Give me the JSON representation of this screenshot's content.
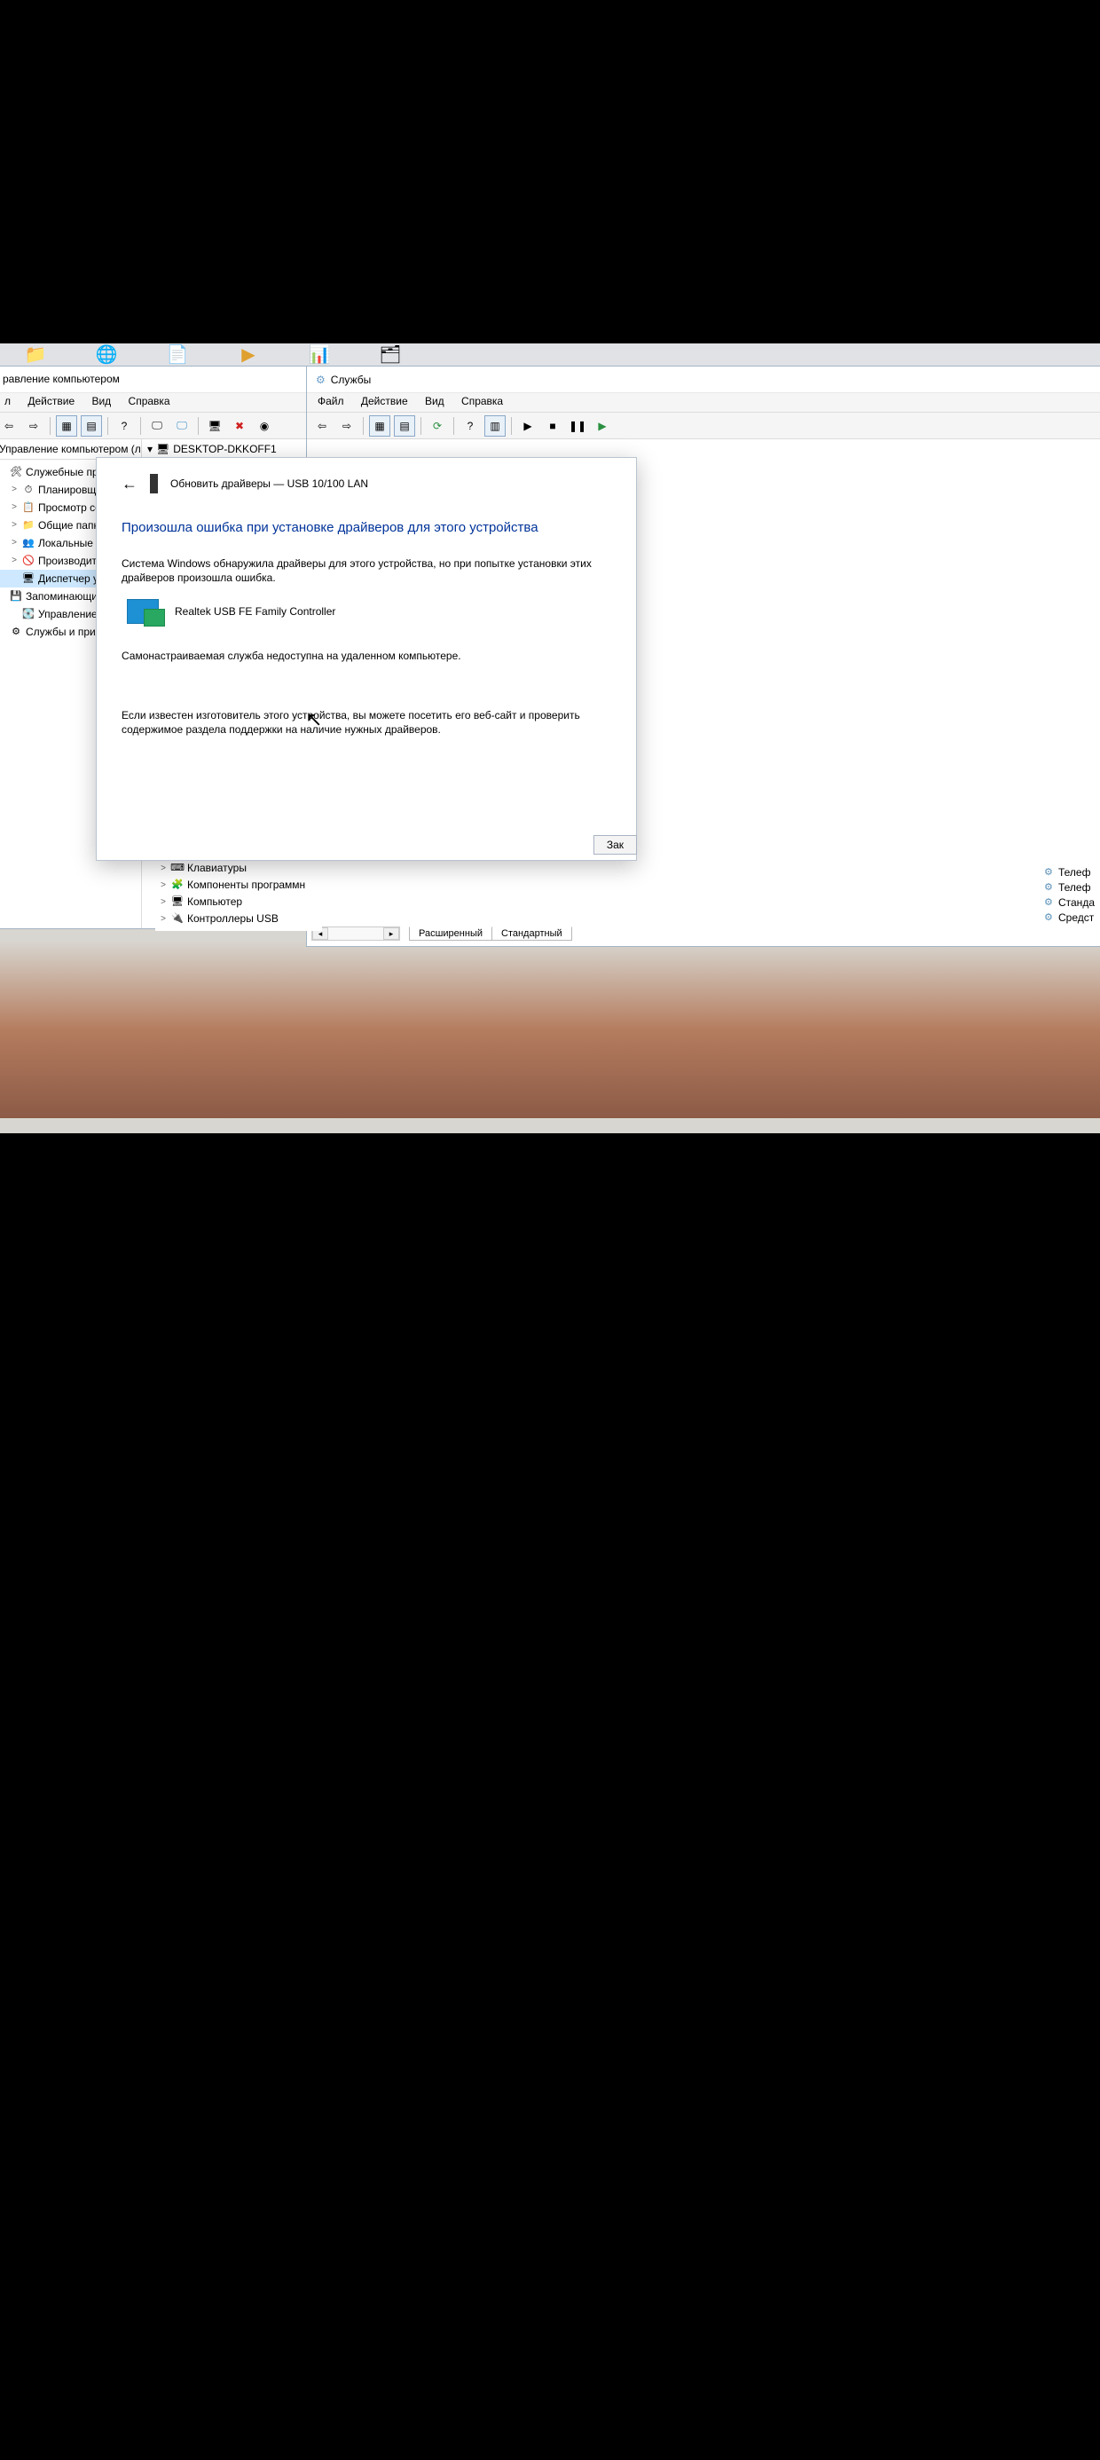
{
  "taskbar_icons": [
    "📁",
    "🌐",
    "📄",
    "▶",
    "📊",
    "🗂"
  ],
  "cm": {
    "title": "равление компьютером",
    "menu": {
      "file": "л",
      "action": "Действие",
      "view": "Вид",
      "help": "Справка"
    },
    "header_left": "Управление компьютером (лс",
    "header_right": "DESKTOP-DKKOFF1",
    "tree": [
      {
        "exp": "",
        "icon": "🛠",
        "label": "Служебные про"
      },
      {
        "exp": ">",
        "icon": "⏱",
        "label": "Планировщ",
        "ind": 1
      },
      {
        "exp": ">",
        "icon": "📋",
        "label": "Просмотр сс",
        "ind": 1
      },
      {
        "exp": ">",
        "icon": "📁",
        "label": "Общие папк",
        "ind": 1
      },
      {
        "exp": ">",
        "icon": "👥",
        "label": "Локальные п",
        "ind": 1
      },
      {
        "exp": ">",
        "icon": "🚫",
        "label": "Производит",
        "ind": 1
      },
      {
        "exp": "",
        "icon": "🖥",
        "label": "Диспетчер у",
        "ind": 1,
        "sel": true
      },
      {
        "exp": "",
        "icon": "💾",
        "label": "Запоминающие"
      },
      {
        "exp": "",
        "icon": "💽",
        "label": "Управление",
        "ind": 1
      },
      {
        "exp": "",
        "icon": "⚙",
        "label": "Службы и прило"
      }
    ]
  },
  "sv": {
    "title": "Службы",
    "menu": {
      "file": "Файл",
      "action": "Действие",
      "view": "Вид",
      "help": "Справка"
    },
    "right_items": [
      {
        "icon": "⚙",
        "label": "Телеф"
      },
      {
        "icon": "⚙",
        "label": "Телеф"
      },
      {
        "icon": "⚙",
        "label": "Станда"
      },
      {
        "icon": "⚙",
        "label": "Средст"
      }
    ],
    "tabs": {
      "ext": "Расширенный",
      "std": "Стандартный"
    }
  },
  "dev_tree": [
    {
      "exp": ">",
      "icon": "⌨",
      "label": "Клавиатуры"
    },
    {
      "exp": ">",
      "icon": "🧩",
      "label": "Компоненты программн"
    },
    {
      "exp": ">",
      "icon": "🖥",
      "label": "Компьютер"
    },
    {
      "exp": ">",
      "icon": "🔌",
      "label": "Контроллеры USB"
    }
  ],
  "dlg": {
    "breadcrumb": "Обновить драйверы — USB 10/100 LAN",
    "heading": "Произошла ошибка при установке драйверов для этого устройства",
    "para1": "Система Windows обнаружила драйверы для этого устройства, но при попытке установки этих драйверов произошла ошибка.",
    "device_name": "Realtek USB FE Family Controller",
    "status": "Самонастраиваемая служба недоступна на удаленном компьютере.",
    "hint": "Если известен изготовитель этого устройства, вы можете посетить его веб-сайт и проверить содержимое раздела поддержки на наличие нужных драйверов.",
    "close_btn": "Зак"
  }
}
